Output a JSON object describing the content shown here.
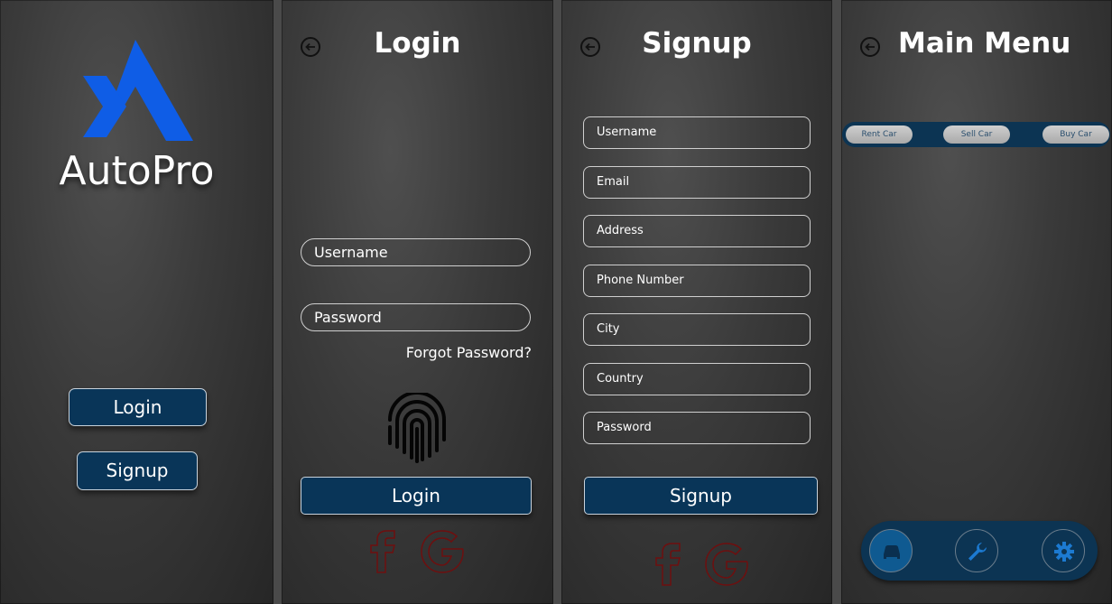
{
  "splash": {
    "brand": "AutoPro",
    "login_label": "Login",
    "signup_label": "Signup"
  },
  "login": {
    "title": "Login",
    "username_placeholder": "Username",
    "password_placeholder": "Password",
    "forgot_label": "Forgot Password?",
    "login_label": "Login"
  },
  "signup": {
    "title": "Signup",
    "fields": [
      "Username",
      "Email",
      "Address",
      "Phone Number",
      "City",
      "Country",
      "Password"
    ],
    "signup_label": "Signup"
  },
  "main_menu": {
    "title": "Main Menu",
    "tabs": [
      "Rent Car",
      "Sell Car",
      "Buy Car"
    ]
  },
  "colors": {
    "navy": "#093558",
    "logo_blue": "#0f5de6",
    "social_red": "#6e0f0f"
  },
  "icons": [
    "back-arrow-icon",
    "fingerprint-icon",
    "facebook-icon",
    "google-icon",
    "car-icon",
    "wrench-icon",
    "gear-icon"
  ]
}
